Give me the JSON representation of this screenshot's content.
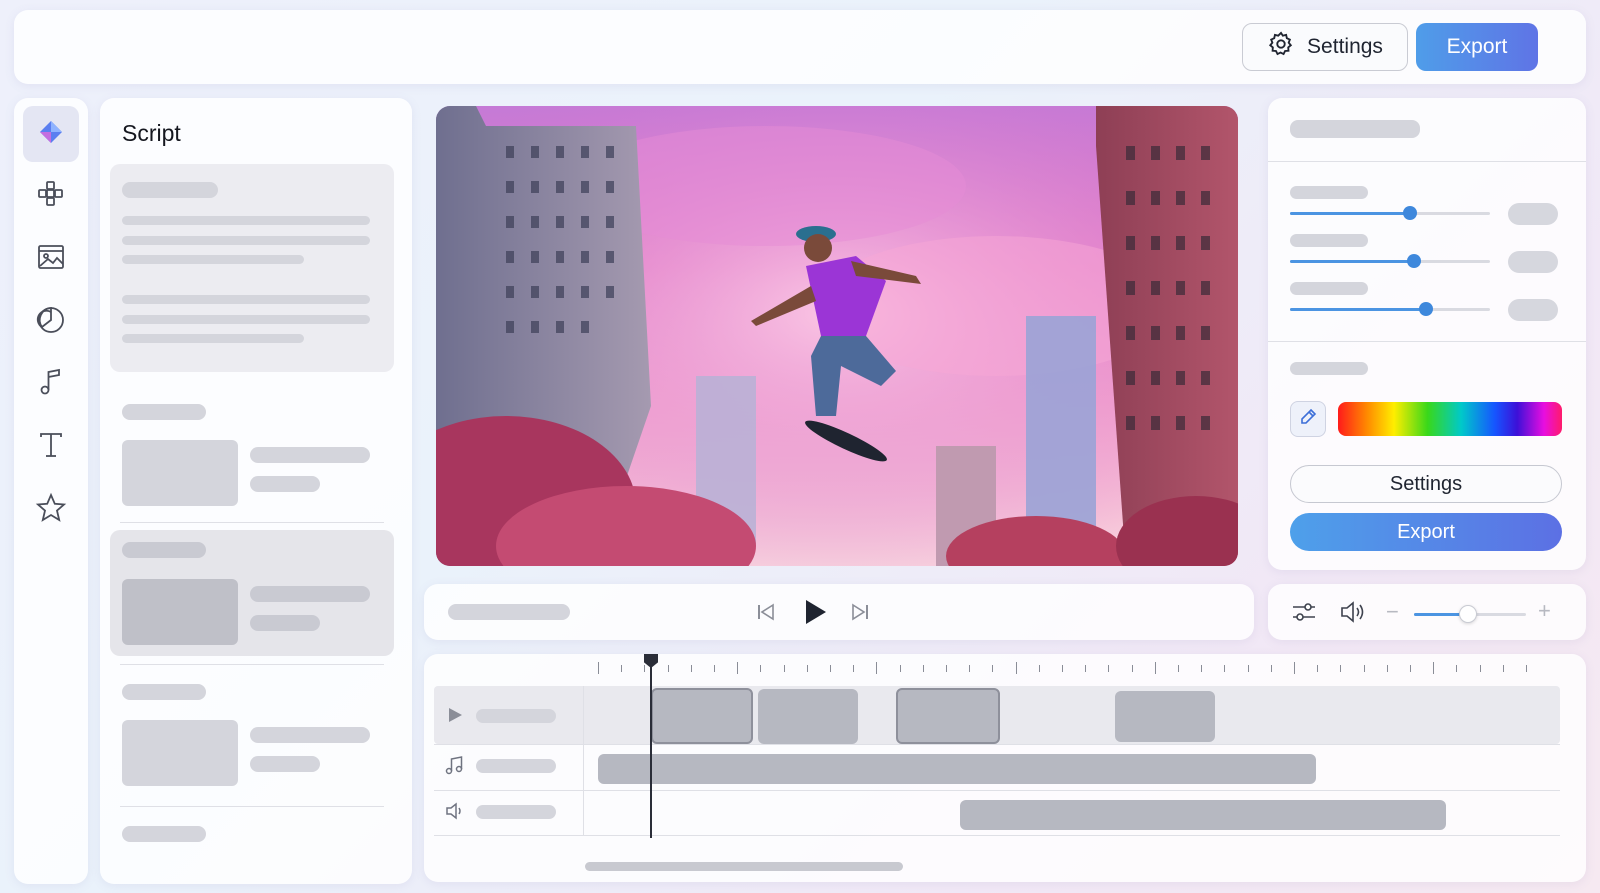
{
  "header": {
    "settings_label": "Settings",
    "export_label": "Export"
  },
  "rail": {
    "icons": [
      "brand-icon",
      "layout-icon",
      "media-icon",
      "effects-icon",
      "music-icon",
      "text-icon",
      "favorites-icon"
    ],
    "accent": "#4f7fe8"
  },
  "script_panel": {
    "title": "Script"
  },
  "preview": {
    "description_colors": [
      "#c57ad6",
      "#e77fc6",
      "#f6a6cc"
    ]
  },
  "inspector": {
    "sliders": [
      0.6,
      0.62,
      0.68
    ],
    "settings_label": "Settings",
    "export_label": "Export"
  },
  "audio": {
    "volume": 0.48
  },
  "colors": {
    "accent": "#4b94e2",
    "export_gradient_start": "#4f9de9",
    "export_gradient_end": "#5f74e6"
  }
}
